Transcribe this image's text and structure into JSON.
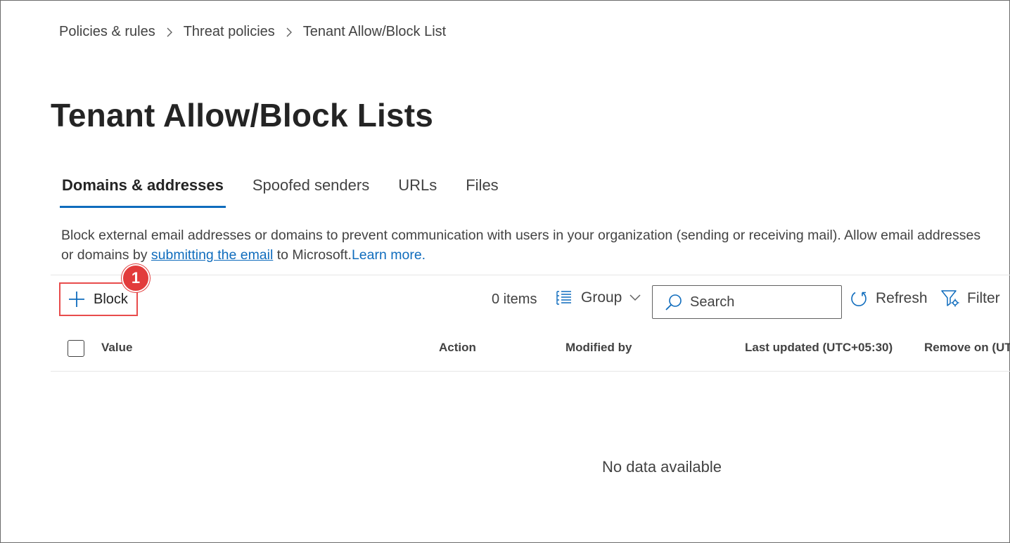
{
  "breadcrumb": {
    "items": [
      "Policies & rules",
      "Threat policies",
      "Tenant Allow/Block List"
    ]
  },
  "page": {
    "title": "Tenant Allow/Block Lists"
  },
  "tabs": [
    {
      "label": "Domains & addresses",
      "active": true
    },
    {
      "label": "Spoofed senders",
      "active": false
    },
    {
      "label": "URLs",
      "active": false
    },
    {
      "label": "Files",
      "active": false
    }
  ],
  "description": {
    "text_before": "Block external email addresses or domains to prevent communication with users in your organization (sending or receiving mail). Allow email addresses or domains by ",
    "link_submit": "submitting the email",
    "text_after": " to Microsoft.",
    "link_learn": "Learn more."
  },
  "toolbar": {
    "block_label": "Block",
    "callout_number": "1",
    "items_count": "0 items",
    "group_label": "Group",
    "search_placeholder": "Search",
    "refresh_label": "Refresh",
    "filter_label": "Filter"
  },
  "table": {
    "columns": [
      "Value",
      "Action",
      "Modified by",
      "Last updated (UTC+05:30)",
      "Remove on (UTC"
    ],
    "rows": [],
    "empty_message": "No data available"
  },
  "colors": {
    "accent": "#0f6cbd",
    "callout": "#e23b3b",
    "text": "#242424"
  },
  "icons": [
    "chevron-right-icon",
    "plus-icon",
    "group-list-icon",
    "chevron-down-icon",
    "search-icon",
    "refresh-icon",
    "filter-icon"
  ]
}
